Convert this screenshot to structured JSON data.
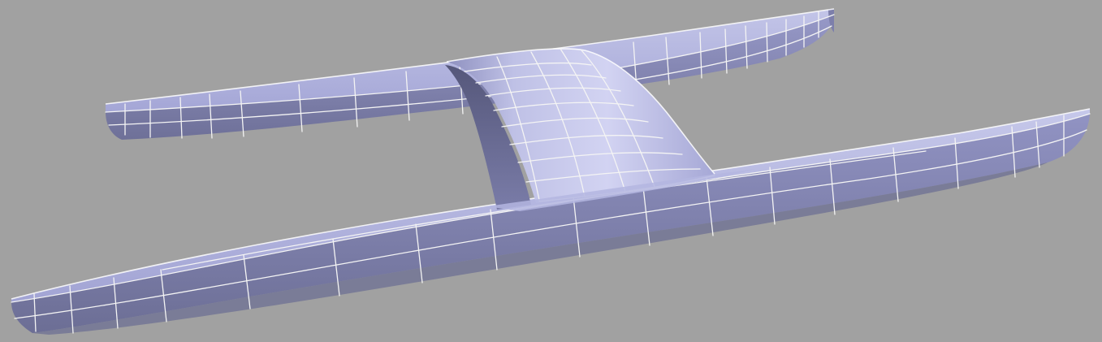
{
  "viewport": {
    "background_color": "#a1a1a1"
  },
  "model": {
    "object_type": "catamaran-hull",
    "parts": [
      "rear-hull",
      "front-hull",
      "crossbeam"
    ],
    "colors": {
      "surface_light": "#c4c6e9",
      "surface_mid": "#9a9cce",
      "surface_dark": "#6f7199",
      "wireframe": "#f4f4f4"
    }
  }
}
